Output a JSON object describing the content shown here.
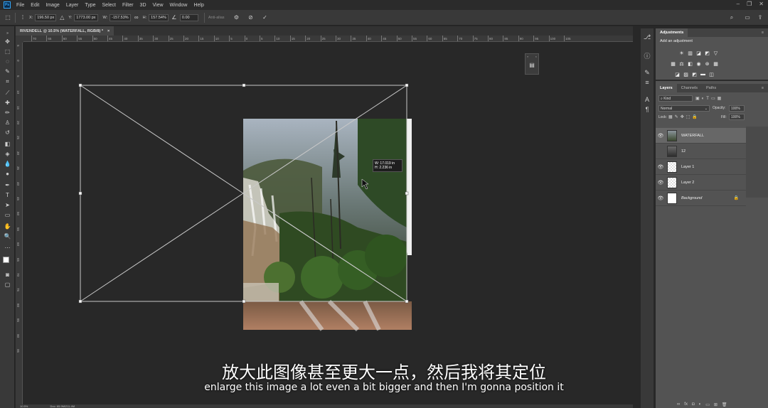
{
  "menu": {
    "logo": "Ps",
    "items": [
      "File",
      "Edit",
      "Image",
      "Layer",
      "Type",
      "Select",
      "Filter",
      "3D",
      "View",
      "Window",
      "Help"
    ]
  },
  "options": {
    "x_label": "X:",
    "x_value": "196.50 px",
    "y_label": "Y:",
    "y_value": "1773.00 px",
    "w_label": "W:",
    "w_value": "-157.53%",
    "h_label": "H:",
    "h_value": "157.54%",
    "angle_value": "0.00",
    "interp_label": "Anti-alias"
  },
  "document": {
    "tab_title": "RIVENDELL @ 10.5% (WATERFALL, RGB/8) *",
    "close": "×"
  },
  "rulers": {
    "top": [
      "70",
      "65",
      "60",
      "55",
      "50",
      "45",
      "40",
      "35",
      "30",
      "25",
      "20",
      "15",
      "10",
      "5",
      "0",
      "5",
      "10",
      "15",
      "20",
      "25",
      "30",
      "35",
      "40",
      "45",
      "50",
      "55",
      "60",
      "65",
      "70",
      "75",
      "80",
      "85",
      "90",
      "95",
      "100",
      "105"
    ],
    "left": [
      "5",
      "0",
      "5",
      "10",
      "15",
      "20",
      "25",
      "30",
      "35",
      "40",
      "45",
      "50",
      "55",
      "60",
      "65",
      "70",
      "75",
      "80",
      "85",
      "90",
      "95"
    ]
  },
  "measure": {
    "w_label": "W:",
    "w_value": "17.019 in",
    "h_label": "H:",
    "h_value": "2.236 in"
  },
  "adjustments": {
    "tab": "Adjustments",
    "heading": "Add an adjustment"
  },
  "layers": {
    "tabs": [
      "Layers",
      "Channels",
      "Paths"
    ],
    "kind_placeholder": "Kind",
    "blend_mode": "Normal",
    "opacity_label": "Opacity:",
    "opacity_value": "100%",
    "lock_label": "Lock:",
    "fill_label": "Fill:",
    "fill_value": "100%",
    "items": [
      {
        "name": "WATERFALL",
        "visible": true,
        "selected": true
      },
      {
        "name": "12",
        "visible": false,
        "selected": false
      },
      {
        "name": "Layer 1",
        "visible": true,
        "selected": false
      },
      {
        "name": "Layer 2",
        "visible": true,
        "selected": false
      },
      {
        "name": "Background",
        "visible": true,
        "selected": false,
        "locked": true
      }
    ]
  },
  "subtitles": {
    "zh": "放大此图像甚至更大一点，然后我将其定位",
    "en": "enlarge this image a lot even a bit bigger and then I'm gonna position it"
  },
  "status": {
    "zoom": "10.5%",
    "doc": "Doc: 65.9M/211.4M"
  }
}
